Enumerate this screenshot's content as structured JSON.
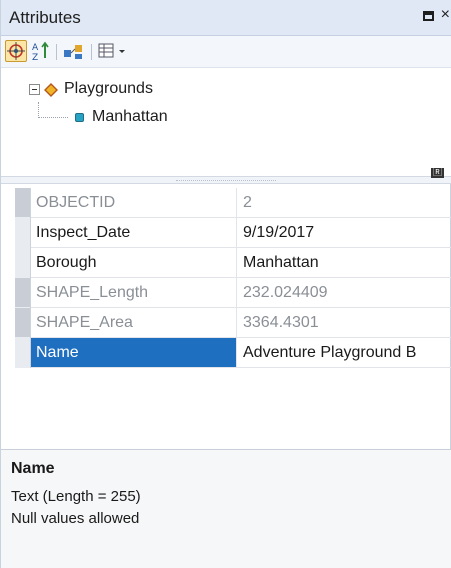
{
  "window": {
    "title": "Attributes",
    "close_glyph": "×"
  },
  "toolbar": {
    "buttons": [
      {
        "icon": "layer-select-icon"
      },
      {
        "icon": "sort-ascending-icon"
      },
      {
        "icon": "relate-icon"
      },
      {
        "icon": "table-options-icon"
      }
    ]
  },
  "tree": {
    "layer": "Playgrounds",
    "feature": "Manhattan"
  },
  "splitter": {
    "badge": "🅁"
  },
  "attributes": {
    "rows": [
      {
        "field": "OBJECTID",
        "value": "2"
      },
      {
        "field": "Inspect_Date",
        "value": "9/19/2017"
      },
      {
        "field": "Borough",
        "value": "Manhattan"
      },
      {
        "field": "SHAPE_Length",
        "value": "232.024409"
      },
      {
        "field": "SHAPE_Area",
        "value": "3364.4301"
      },
      {
        "field": "Name",
        "value": "Adventure Playground B"
      }
    ]
  },
  "description": {
    "title": "Name",
    "line1": "Text (Length = 255)",
    "line2": "Null values allowed"
  },
  "colors": {
    "selection": "#1f6fc1",
    "titlebar": "#dfe8f4",
    "readonly_text": "#8a8f96"
  }
}
